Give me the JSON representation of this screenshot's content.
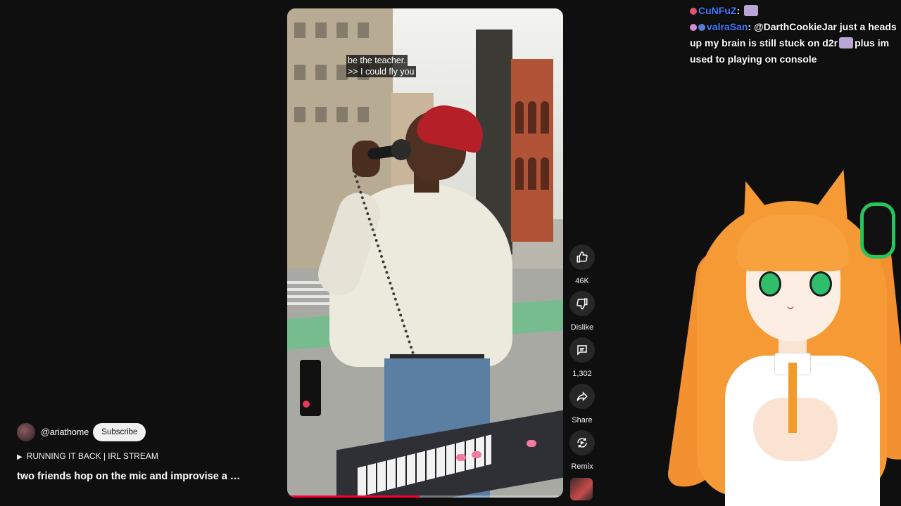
{
  "video": {
    "subtitle_line1": "be the teacher.",
    "subtitle_line2": ">> I could fly you",
    "progress": 0.48
  },
  "actions": {
    "like_count": "46K",
    "dislike_label": "Dislike",
    "comment_count": "1,302",
    "share_label": "Share",
    "remix_label": "Remix"
  },
  "channel": {
    "handle": "@ariathome",
    "subscribe_label": "Subscribe",
    "live_label": "RUNNING IT BACK | IRL STREAM",
    "short_title": "two friends hop on the mic and improvise a …"
  },
  "chat": {
    "messages": [
      {
        "user": "CuNFuZ",
        "text": ""
      },
      {
        "user": "valraSan",
        "text": "@DarthCookieJar just a heads up my brain is still stuck on d2r",
        "text_after_emote": "plus im used to playing on console"
      }
    ]
  },
  "colors": {
    "background": "#0f0f0f",
    "progress": "#ff0033",
    "chat_username": "#3f7fff",
    "button_bg": "#272727"
  },
  "icons": [
    "thumb-up-icon",
    "thumb-down-icon",
    "comment-icon",
    "share-icon",
    "remix-icon"
  ]
}
